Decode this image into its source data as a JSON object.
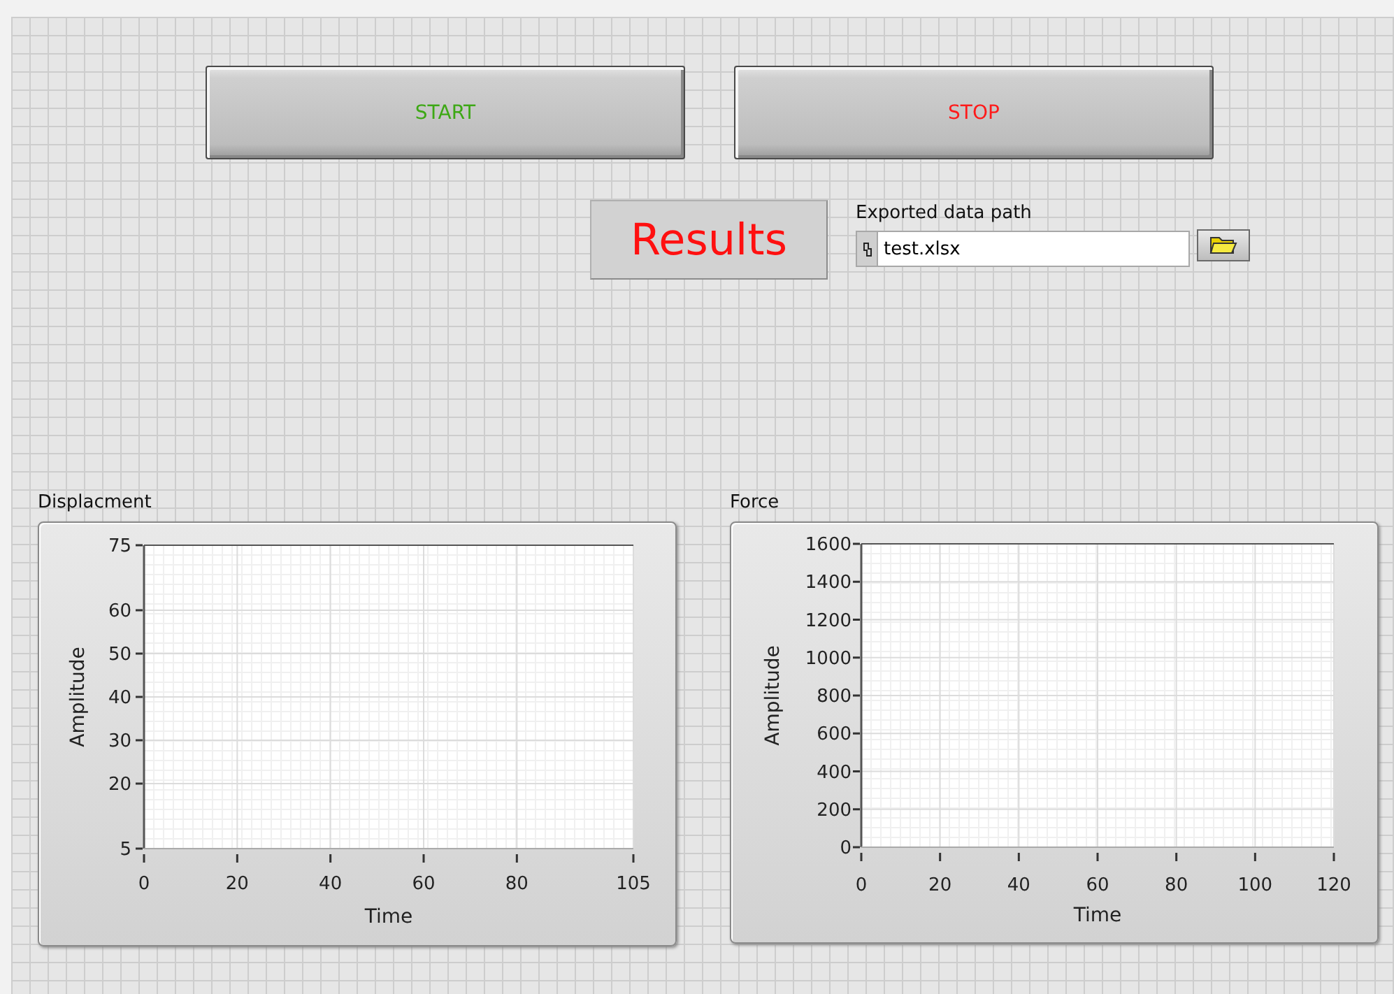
{
  "buttons": [
    {
      "label": "START",
      "color": "#3da815"
    },
    {
      "label": "STOP",
      "color": "#ff1a1a"
    }
  ],
  "results": {
    "text": "Results"
  },
  "path_control": {
    "label": "Exported data path",
    "value": "test.xlsx"
  },
  "graphs": [
    {
      "chart_data": {
        "type": "line",
        "title": "Displacment",
        "xlabel": "Time",
        "ylabel": "Amplitude",
        "grid": true,
        "xlim": [
          0,
          105
        ],
        "ylim": [
          5,
          75
        ],
        "xticks": [
          0,
          20,
          40,
          60,
          80,
          105
        ],
        "yticks": [
          5,
          20,
          30,
          40,
          50,
          60,
          75
        ]
      }
    },
    {
      "chart_data": {
        "type": "line",
        "title": "Force",
        "xlabel": "Time",
        "ylabel": "Amplitude",
        "grid": true,
        "xlim": [
          0,
          120
        ],
        "ylim": [
          0,
          1600
        ],
        "xticks": [
          0,
          20,
          40,
          60,
          80,
          100,
          120
        ],
        "yticks": [
          0,
          200,
          400,
          600,
          800,
          1000,
          1200,
          1400,
          1600
        ]
      }
    }
  ]
}
